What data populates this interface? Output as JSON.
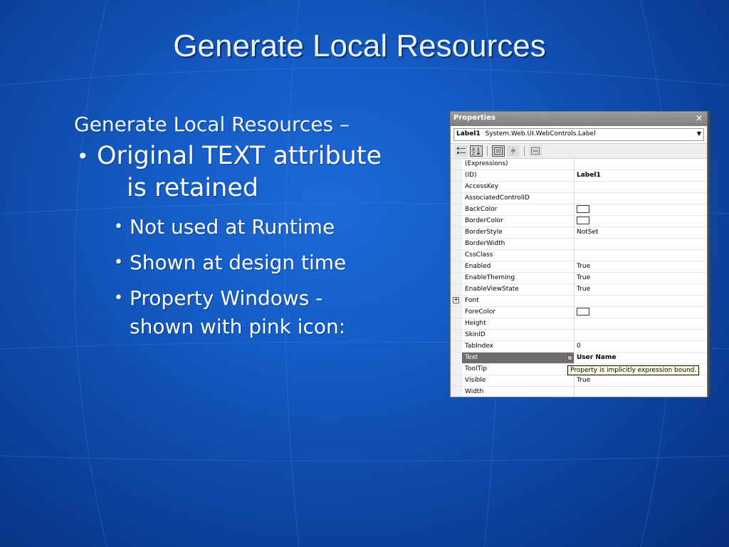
{
  "slide": {
    "title": "Generate Local Resources",
    "lead": "Generate Local Resources –",
    "bullet1_line1": "Original TEXT attribute",
    "bullet1_line2": "is retained",
    "sub_bullets": [
      "Not used at Runtime",
      "Shown at design time",
      "Property Windows -",
      "shown with pink icon:"
    ],
    "bullet_glyph": "•"
  },
  "properties_window": {
    "title": "Properties",
    "close_glyph": "✕",
    "object_name": "Label1",
    "object_type": "System.Web.UI.WebControls.Label",
    "toolbar_icons": [
      "categorized-icon",
      "alphabetical-icon",
      "properties-icon",
      "events-icon",
      "property-pages-icon"
    ],
    "rows": [
      {
        "name": "(Expressions)",
        "value": ""
      },
      {
        "name": "(ID)",
        "value": "Label1"
      },
      {
        "name": "AccessKey",
        "value": ""
      },
      {
        "name": "AssociatedControlID",
        "value": ""
      },
      {
        "name": "BackColor",
        "value": ""
      },
      {
        "name": "BorderColor",
        "value": ""
      },
      {
        "name": "BorderStyle",
        "value": "NotSet"
      },
      {
        "name": "BorderWidth",
        "value": ""
      },
      {
        "name": "CssClass",
        "value": ""
      },
      {
        "name": "Enabled",
        "value": "True"
      },
      {
        "name": "EnableTheming",
        "value": "True"
      },
      {
        "name": "EnableViewState",
        "value": "True"
      },
      {
        "name": "Font",
        "value": ""
      },
      {
        "name": "ForeColor",
        "value": ""
      },
      {
        "name": "Height",
        "value": ""
      },
      {
        "name": "SkinID",
        "value": ""
      },
      {
        "name": "TabIndex",
        "value": "0"
      },
      {
        "name": "Text",
        "value": "User Name"
      },
      {
        "name": "ToolTip",
        "value": ""
      },
      {
        "name": "Visible",
        "value": "True"
      },
      {
        "name": "Width",
        "value": ""
      }
    ],
    "tooltip": "Property is implicitly expression bound.",
    "pink_icon_color": "#e9a8c6"
  }
}
